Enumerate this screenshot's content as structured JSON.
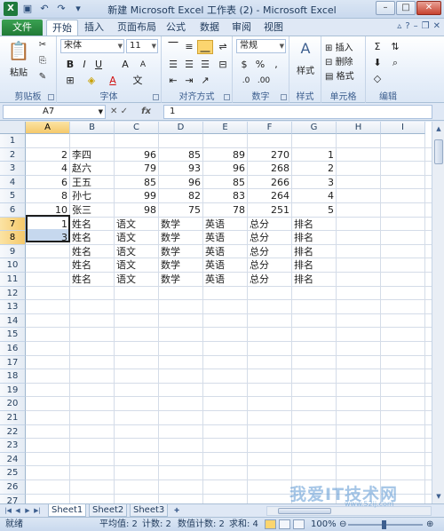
{
  "window": {
    "title": "新建 Microsoft Excel 工作表 (2) - Microsoft Excel",
    "qat": [
      "excel-logo",
      "save-icon",
      "undo-icon",
      "redo-icon",
      "customize-icon"
    ],
    "controls": [
      "minimize",
      "maximize",
      "close"
    ]
  },
  "tabs": {
    "file": "文件",
    "items": [
      "开始",
      "插入",
      "页面布局",
      "公式",
      "数据",
      "审阅",
      "视图"
    ],
    "active": "开始"
  },
  "ribbon": {
    "clipboard": {
      "label": "剪贴板",
      "paste": "粘贴"
    },
    "font": {
      "label": "字体",
      "name": "宋体",
      "size": "11",
      "bold": "B",
      "italic": "I",
      "underline": "U",
      "grow": "A",
      "shrink": "A",
      "fill": "A",
      "color": "A"
    },
    "alignment": {
      "label": "对齐方式"
    },
    "number": {
      "label": "数字",
      "format": "常规",
      "percent": "%",
      "comma": ","
    },
    "styles": {
      "label": "样式",
      "button": "样式"
    },
    "cells": {
      "label": "单元格",
      "insert": "插入",
      "delete": "删除",
      "format": "格式"
    },
    "editing": {
      "label": "编辑",
      "sum": "Σ"
    }
  },
  "formula_bar": {
    "name_box": "A7",
    "fx": "fx",
    "value": "1"
  },
  "grid": {
    "columns": [
      "A",
      "B",
      "C",
      "D",
      "E",
      "F",
      "G",
      "H",
      "I"
    ],
    "rows": [
      "1",
      "2",
      "3",
      "4",
      "5",
      "6",
      "7",
      "8",
      "9",
      "10",
      "11",
      "12",
      "13",
      "14",
      "15",
      "16",
      "17",
      "18",
      "19",
      "20",
      "21",
      "22",
      "23",
      "24",
      "25",
      "26",
      "27"
    ],
    "cells": {
      "A2": "2",
      "B2": "李四",
      "C2": "96",
      "D2": "85",
      "E2": "89",
      "F2": "270",
      "G2": "1",
      "A3": "4",
      "B3": "赵六",
      "C3": "79",
      "D3": "93",
      "E3": "96",
      "F3": "268",
      "G3": "2",
      "A4": "6",
      "B4": "王五",
      "C4": "85",
      "D4": "96",
      "E4": "85",
      "F4": "266",
      "G4": "3",
      "A5": "8",
      "B5": "孙七",
      "C5": "99",
      "D5": "82",
      "E5": "83",
      "F5": "264",
      "G5": "4",
      "A6": "10",
      "B6": "张三",
      "C6": "98",
      "D6": "75",
      "E6": "78",
      "F6": "251",
      "G6": "5",
      "A7": "1",
      "B7": "姓名",
      "C7": "语文",
      "D7": "数学",
      "E7": "英语",
      "F7": "总分",
      "G7": "排名",
      "A8": "3",
      "B8": "姓名",
      "C8": "语文",
      "D8": "数学",
      "E8": "英语",
      "F8": "总分",
      "G8": "排名",
      "B9": "姓名",
      "C9": "语文",
      "D9": "数学",
      "E9": "英语",
      "F9": "总分",
      "G9": "排名",
      "B10": "姓名",
      "C10": "语文",
      "D10": "数学",
      "E10": "英语",
      "F10": "总分",
      "G10": "排名",
      "B11": "姓名",
      "C11": "语文",
      "D11": "数学",
      "E11": "英语",
      "F11": "总分",
      "G11": "排名"
    }
  },
  "sheets": [
    "Sheet1",
    "Sheet2",
    "Sheet3"
  ],
  "status": {
    "mode": "就绪",
    "average": "平均值: 2",
    "count": "计数: 2",
    "numeric_count": "数值计数: 2",
    "sum": "求和: 4",
    "zoom": "100%"
  },
  "watermark": {
    "text": "我爱IT技术网",
    "sub": "www.52ij.com"
  }
}
